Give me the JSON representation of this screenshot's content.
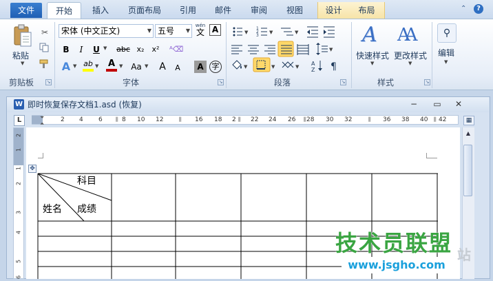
{
  "tabs": {
    "file": "文件",
    "home": "开始",
    "insert": "插入",
    "page_layout": "页面布局",
    "references": "引用",
    "mailings": "邮件",
    "review": "审阅",
    "view": "视图",
    "design": "设计",
    "layout": "布局"
  },
  "clipboard": {
    "paste_label": "粘贴",
    "group_label": "剪贴板",
    "icons": [
      "cut-icon",
      "copy-icon",
      "format-painter-icon"
    ]
  },
  "font": {
    "family": "宋体 (中文正文)",
    "size": "五号",
    "group_label": "字体",
    "bold": "B",
    "italic": "I",
    "underline": "U",
    "strike": "abc",
    "subscript": "x₂",
    "superscript": "x²",
    "grow": "A",
    "shrink": "A",
    "change_case": "Aa",
    "char_shading": "A",
    "enclose": "字",
    "phonetic": "wén",
    "phonetic_char": "文",
    "clear_format": "A",
    "highlight_color": "#ffff00",
    "font_color": "#c00000",
    "text_effect": "A",
    "highlight_glyph": "ab",
    "font_color_glyph": "A"
  },
  "paragraph": {
    "group_label": "段落"
  },
  "styles": {
    "quick_styles": "快速样式",
    "change_styles": "更改样式",
    "group_label": "样式"
  },
  "editing": {
    "label": "编辑"
  },
  "document": {
    "title": "即时恢复保存文档1.asd (恢复)",
    "word_icon_letter": "W"
  },
  "ruler": {
    "corner": "L",
    "numbers": [
      "2",
      "4",
      "6",
      "8",
      "10",
      "12",
      "16",
      "18",
      "2",
      "22",
      "24",
      "26",
      "28",
      "30",
      "32",
      "36",
      "38",
      "40",
      "42"
    ],
    "vnumbers": [
      "2",
      "1",
      "1",
      "2",
      "3",
      "4",
      "5",
      "6"
    ]
  },
  "table": {
    "header_subject": "科目",
    "header_name": "姓名",
    "header_score": "成绩"
  },
  "watermark": {
    "main": "技术员联盟",
    "url": "www.jsgho.com",
    "ghost": "站"
  }
}
